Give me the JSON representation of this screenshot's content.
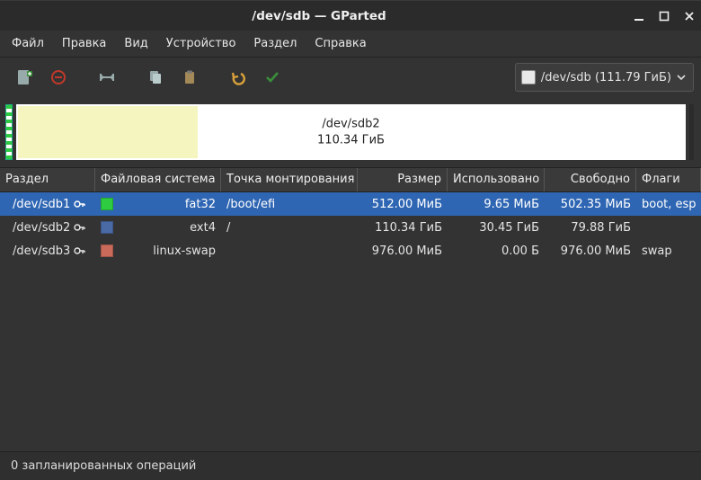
{
  "window": {
    "title": "/dev/sdb — GParted"
  },
  "menu": {
    "file": "Файл",
    "edit": "Правка",
    "view": "Вид",
    "device": "Устройство",
    "partition": "Раздел",
    "help": "Справка"
  },
  "toolbar": {
    "new_label": "Создать",
    "delete_label": "Удалить",
    "resize_label": "Изменить размер",
    "copy_label": "Копировать",
    "paste_label": "Вставить",
    "undo_label": "Отменить",
    "apply_label": "Применить"
  },
  "device_selector": {
    "label": "/dev/sdb (111.79 ГиБ)"
  },
  "disk_graphic": {
    "main_partition": "/dev/sdb2",
    "main_size": "110.34 ГиБ",
    "used_fraction": 0.27
  },
  "columns": {
    "partition": "Раздел",
    "filesystem": "Файловая система",
    "mountpoint": "Точка монтирования",
    "size": "Размер",
    "used": "Использовано",
    "free": "Свободно",
    "flags": "Флаги"
  },
  "fs_colors": {
    "fat32": "#2ecc40",
    "ext4": "#4a6aa5",
    "linux-swap": "#c96a5a"
  },
  "partitions": [
    {
      "name": "/dev/sdb1",
      "locked": true,
      "fs": "fat32",
      "mount": "/boot/efi",
      "size": "512.00 МиБ",
      "used": "9.65 МиБ",
      "free": "502.35 МиБ",
      "flags": "boot, esp",
      "selected": true
    },
    {
      "name": "/dev/sdb2",
      "locked": true,
      "fs": "ext4",
      "mount": "/",
      "size": "110.34 ГиБ",
      "used": "30.45 ГиБ",
      "free": "79.88 ГиБ",
      "flags": "",
      "selected": false
    },
    {
      "name": "/dev/sdb3",
      "locked": true,
      "fs": "linux-swap",
      "mount": "",
      "size": "976.00 МиБ",
      "used": "0.00 Б",
      "free": "976.00 МиБ",
      "flags": "swap",
      "selected": false
    }
  ],
  "status": {
    "text": "0 запланированных операций"
  }
}
